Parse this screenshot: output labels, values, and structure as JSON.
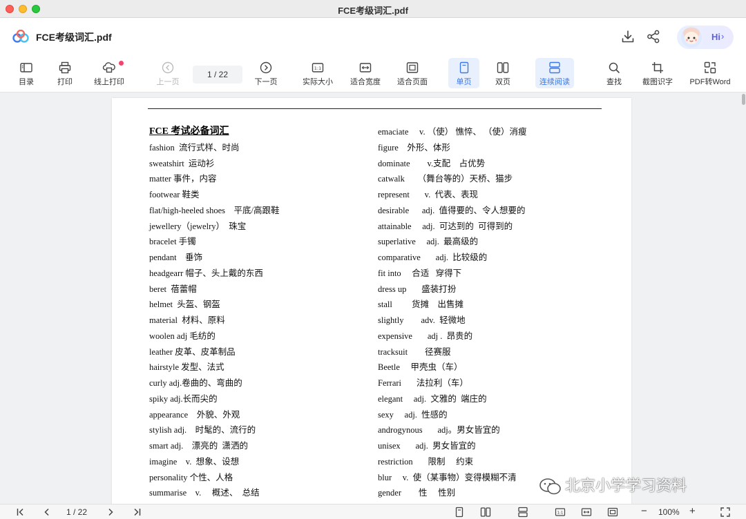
{
  "window": {
    "title": "FCE考级词汇.pdf"
  },
  "header": {
    "doc_title": "FCE考级词汇.pdf",
    "assistant_label": "Hi",
    "icons": [
      "download-icon",
      "share-icon"
    ]
  },
  "toolbar": {
    "toc": "目录",
    "print": "打印",
    "online_print": "线上打印",
    "prev_page": "上一页",
    "page_indicator": "1 / 22",
    "next_page": "下一页",
    "actual_size": "实际大小",
    "fit_width": "适合宽度",
    "fit_page": "适合页面",
    "single_page": "单页",
    "double_page": "双页",
    "continuous": "连续阅读",
    "search": "查找",
    "ocr": "截图识字",
    "pdf_to_word": "PDF转Word"
  },
  "document": {
    "heading": "FCE 考试必备词汇",
    "left_column": [
      "fashion  流行式样、时尚",
      "sweatshirt  运动衫",
      "matter 事件，内容",
      "footwear 鞋类",
      "flat/high-heeled shoes    平底/高跟鞋",
      "jewellery（jewelry）  珠宝",
      "bracelet 手镯",
      "pendant    垂饰",
      "headgearr 帽子、头上戴的东西",
      "beret  蓓蕾帽",
      "helmet  头盔、钢盔",
      "material  材料、原料",
      "woolen adj 毛纺的",
      "leather 皮革、皮革制品",
      "hairstyle 发型、法式",
      "curly adj.卷曲的、弯曲的",
      "spiky adj.长而尖的",
      "appearance    外貌、外观",
      "stylish adj.    时髦的、流行的",
      "smart adj.    漂亮的  潇洒的",
      "imagine    v.  想象、设想",
      "personality 个性、人格",
      "summarise    v.     概述、  总结"
    ],
    "right_column": [
      "emaciate     v. （使） 憔悴、 （使）消瘦",
      "figure    外形、体形",
      "dominate        v.支配    占优势",
      "catwalk      （舞台等的）天桥、猫步",
      "represent       v.  代表、表现",
      "desirable      adj.  值得要的、令人想要的",
      "attainable     adj.  可达到的  可得到的",
      "superlative     adj.  最高级的",
      "comparative       adj.  比较级的",
      "fit into     合适   穿得下",
      "dress up       盛装打扮",
      "stall         货摊    出售摊",
      "slightly        adv.  轻微地",
      "expensive       adj .  昂贵的",
      "tracksuit        径赛服",
      "Beetle     甲壳虫（车）",
      "Ferrari       法拉利（车）",
      "elegant     adj.  文雅的  端庄的",
      "sexy     adj.  性感的",
      "androgynous       adj。男女皆宜的",
      "unisex       adj.  男女皆宜的",
      "restriction       限制     约束",
      "blur     v.  使（某事物）变得模糊不清",
      "gender        性     性别"
    ]
  },
  "watermark": "北京小学学习资料",
  "bottombar": {
    "page_indicator": "1 / 22",
    "zoom": "100%",
    "zoom_out": "−",
    "zoom_in": "+"
  }
}
